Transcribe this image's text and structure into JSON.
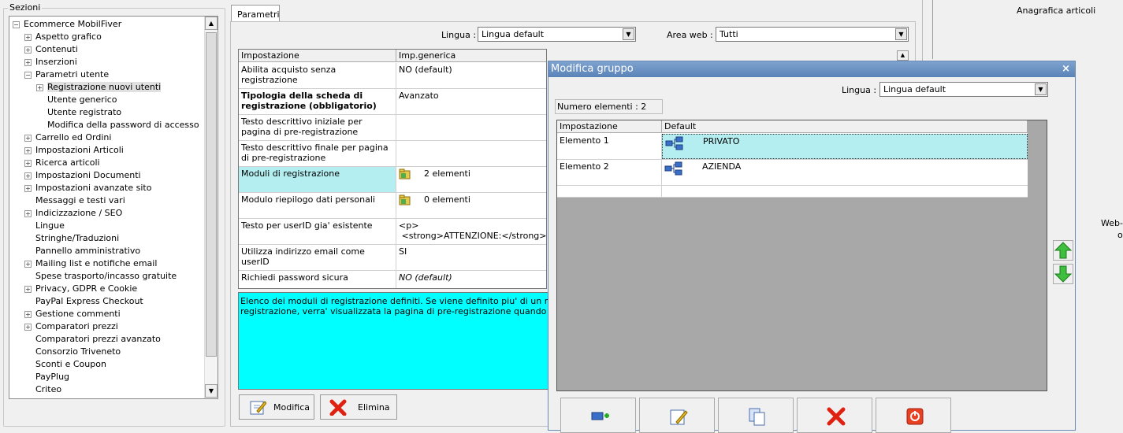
{
  "sections": {
    "title": "Sezioni",
    "tree": [
      {
        "label": "Ecommerce MobilFiver",
        "level": 0,
        "expander": "−"
      },
      {
        "label": "Aspetto grafico",
        "level": 1,
        "expander": "+"
      },
      {
        "label": "Contenuti",
        "level": 1,
        "expander": "+"
      },
      {
        "label": "Inserzioni",
        "level": 1,
        "expander": "+"
      },
      {
        "label": "Parametri utente",
        "level": 1,
        "expander": "−"
      },
      {
        "label": "Registrazione nuovi utenti",
        "level": 2,
        "expander": "+",
        "selected": true
      },
      {
        "label": "Utente generico",
        "level": 2,
        "expander": ""
      },
      {
        "label": "Utente registrato",
        "level": 2,
        "expander": ""
      },
      {
        "label": "Modifica della password di accesso",
        "level": 2,
        "expander": ""
      },
      {
        "label": "Carrello ed Ordini",
        "level": 1,
        "expander": "+"
      },
      {
        "label": "Impostazioni Articoli",
        "level": 1,
        "expander": "+"
      },
      {
        "label": "Ricerca articoli",
        "level": 1,
        "expander": "+"
      },
      {
        "label": "Impostazioni Documenti",
        "level": 1,
        "expander": "+"
      },
      {
        "label": "Impostazioni avanzate sito",
        "level": 1,
        "expander": "+"
      },
      {
        "label": "Messaggi e testi vari",
        "level": 1,
        "expander": ""
      },
      {
        "label": "Indicizzazione / SEO",
        "level": 1,
        "expander": "+"
      },
      {
        "label": "Lingue",
        "level": 1,
        "expander": ""
      },
      {
        "label": "Stringhe/Traduzioni",
        "level": 1,
        "expander": ""
      },
      {
        "label": "Pannello amministrativo",
        "level": 1,
        "expander": ""
      },
      {
        "label": "Mailing list e notifiche email",
        "level": 1,
        "expander": "+"
      },
      {
        "label": "Spese trasporto/incasso gratuite",
        "level": 1,
        "expander": ""
      },
      {
        "label": "Privacy, GDPR e Cookie",
        "level": 1,
        "expander": "+"
      },
      {
        "label": "PayPal Express Checkout",
        "level": 1,
        "expander": ""
      },
      {
        "label": "Gestione commenti",
        "level": 1,
        "expander": "+"
      },
      {
        "label": "Comparatori prezzi",
        "level": 1,
        "expander": "+"
      },
      {
        "label": "Comparatori prezzi avanzato",
        "level": 1,
        "expander": ""
      },
      {
        "label": "Consorzio Triveneto",
        "level": 1,
        "expander": ""
      },
      {
        "label": "Sconti e Coupon",
        "level": 1,
        "expander": ""
      },
      {
        "label": "PayPlug",
        "level": 1,
        "expander": ""
      },
      {
        "label": "Criteo",
        "level": 1,
        "expander": ""
      }
    ]
  },
  "params": {
    "tab": "Parametri",
    "lingua_label": "Lingua :",
    "lingua_value": "Lingua default",
    "area_label": "Area web :",
    "area_value": "Tutti",
    "columns": [
      "Impostazione",
      "Imp.generica"
    ],
    "rows": [
      {
        "name": "Abilita acquisto senza registrazione",
        "value": "NO (default)"
      },
      {
        "name": "Tipologia della scheda di registrazione (obbligatorio)",
        "value": "Avanzato",
        "bold": true
      },
      {
        "name": "Testo descrittivo iniziale per pagina di pre-registrazione",
        "value": ""
      },
      {
        "name": "Testo descrittivo finale per pagina di pre-registrazione",
        "value": ""
      },
      {
        "name": "Moduli di registrazione",
        "value": "2 elementi",
        "icon": "folder-icon",
        "highlight": true
      },
      {
        "name": "Modulo riepilogo dati personali",
        "value": "0 elementi",
        "icon": "folder-icon"
      },
      {
        "name": "Testo per userID gia' esistente",
        "value": "<p>\n <strong>ATTENZIONE:</strong>"
      },
      {
        "name": "Utilizza indirizzo email come userID",
        "value": "SI"
      },
      {
        "name": "Richiedi password sicura",
        "value": "NO (default)",
        "italic": true
      }
    ],
    "description_line1": "Elenco dei moduli di registrazione definiti. Se viene definito piu' di un modulo di reg",
    "description_line2": "registrazione, verra' visualizzata la pagina di pre-registrazione quando l'utente clic",
    "modifica_label": "Modifica",
    "elimina_label": "Elimina"
  },
  "right": {
    "anagrafica_label": "Anagrafica articoli",
    "web_label": "Web-",
    "web_label2": "o"
  },
  "dialog": {
    "title": "Modifica gruppo",
    "close": "×",
    "lingua_label": "Lingua :",
    "lingua_value": "Lingua default",
    "count": "Numero elementi : 2",
    "columns": [
      "Impostazione",
      "Default"
    ],
    "rows": [
      {
        "name": "Elemento 1",
        "value": "PRIVATO",
        "selected": true
      },
      {
        "name": "Elemento 2",
        "value": "AZIENDA"
      }
    ]
  },
  "colors": {
    "highlight": "#b4eef0",
    "description_bg": "#00ffff",
    "dialog_title": "#6a8fc0"
  }
}
